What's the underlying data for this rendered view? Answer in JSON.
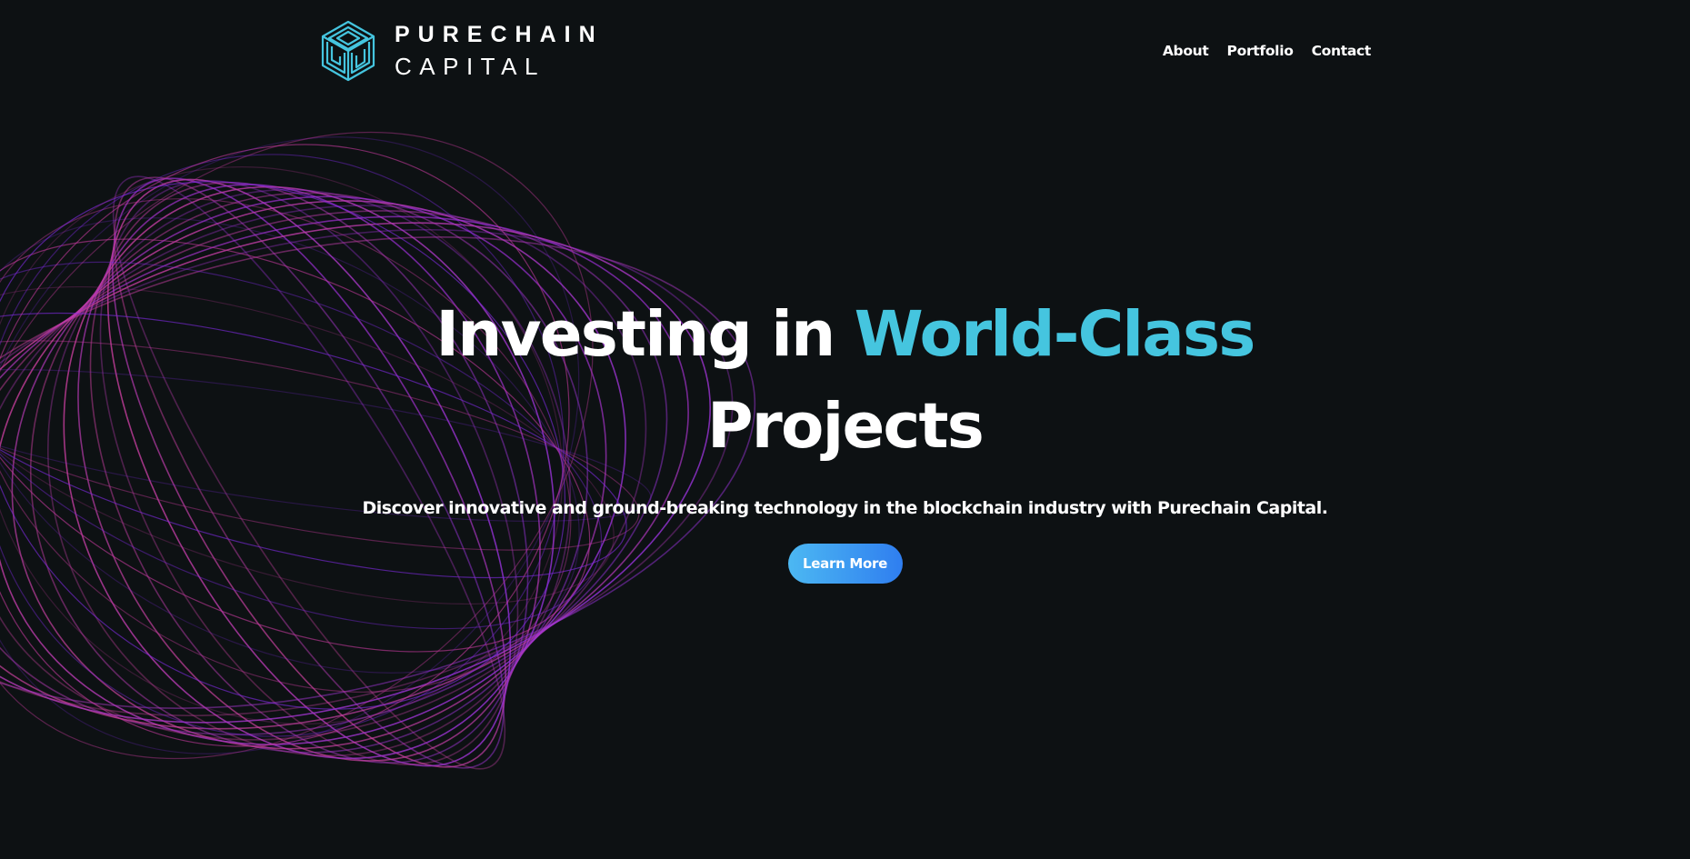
{
  "brand": {
    "line1": "PURECHAIN",
    "line2": "CAPITAL",
    "logo_icon": "cube-maze-logo-icon",
    "logo_color": "#45c5df"
  },
  "nav": {
    "items": [
      {
        "label": "About"
      },
      {
        "label": "Portfolio"
      },
      {
        "label": "Contact"
      }
    ]
  },
  "hero": {
    "title_part1": "Investing in ",
    "title_accent": "World-Class",
    "title_part2": "Projects",
    "subtitle": "Discover innovative and ground-breaking technology in the blockchain industry with Purechain Capital.",
    "cta_label": "Learn More"
  },
  "colors": {
    "background": "#0d1113",
    "accent": "#45c5df",
    "button_gradient_start": "#4cb8f2",
    "button_gradient_end": "#2f7ef0",
    "globe_purple": "#8a2be2",
    "globe_magenta": "#e040a0"
  },
  "decoration": {
    "background_graphic": "wireframe-globe"
  }
}
